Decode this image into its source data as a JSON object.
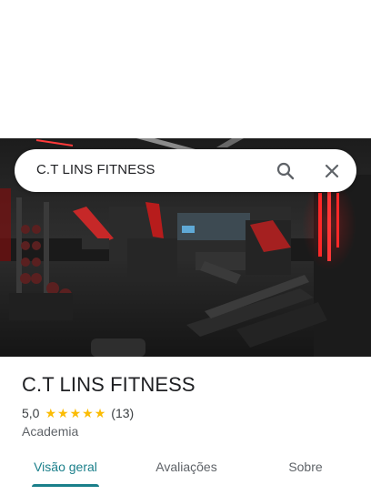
{
  "search": {
    "query": "C.T LINS FITNESS"
  },
  "place": {
    "name": "C.T LINS FITNESS",
    "rating": "5,0",
    "stars": 5,
    "review_count": "(13)",
    "category": "Academia"
  },
  "tabs": [
    {
      "label": "Visão geral",
      "active": true
    },
    {
      "label": "Avaliações",
      "active": false
    },
    {
      "label": "Sobre",
      "active": false
    }
  ],
  "colors": {
    "accent": "#1a7f8a",
    "star": "#fbbc04"
  },
  "icons": {
    "search": "search-icon",
    "close": "close-icon"
  }
}
